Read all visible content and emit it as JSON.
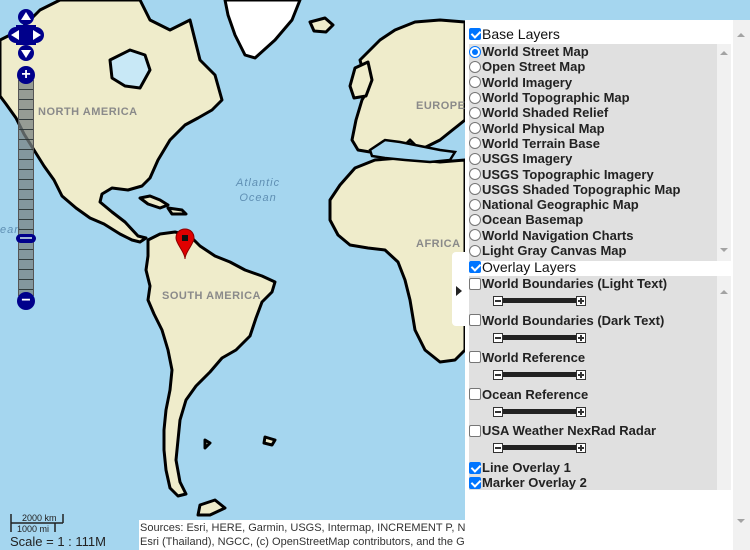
{
  "map": {
    "labels": {
      "north_america": "NORTH AMERICA",
      "south_america": "SOUTH AMERICA",
      "europe": "EUROPE",
      "africa": "AFRICA",
      "atlantic_line1": "Atlantic",
      "atlantic_line2": "Ocean",
      "pacific_fragment": "ean"
    },
    "colors": {
      "ocean": "#a5d6ef",
      "land": "#efeccb",
      "coastline": "#000000",
      "marker": "#e00000",
      "control": "#00008b"
    },
    "controls": {
      "pan_up": "pan-up",
      "pan_down": "pan-down",
      "pan_left": "pan-left",
      "pan_right": "pan-right",
      "zoom_in": "+",
      "zoom_out": "−",
      "zoom_level_fraction": 0.25
    },
    "scale": {
      "km": "2000 km",
      "mi": "1000 mi",
      "text": "Scale = 1 : 111M"
    },
    "attribution": {
      "line1": "Sources: Esri, HERE, Garmin, USGS, Intermap, INCREMENT P, NR",
      "line2": "Esri (Thailand), NGCC, (c) OpenStreetMap contributors, and the GIS"
    }
  },
  "layer_switcher": {
    "base_layers": {
      "label": "Base Layers",
      "checked": true,
      "items": [
        {
          "label": "World Street Map",
          "selected": true
        },
        {
          "label": "Open Street Map",
          "selected": false
        },
        {
          "label": "World Imagery",
          "selected": false
        },
        {
          "label": "World Topographic Map",
          "selected": false
        },
        {
          "label": "World Shaded Relief",
          "selected": false
        },
        {
          "label": "World Physical Map",
          "selected": false
        },
        {
          "label": "World Terrain Base",
          "selected": false
        },
        {
          "label": "USGS Imagery",
          "selected": false
        },
        {
          "label": "USGS Topographic Imagery",
          "selected": false
        },
        {
          "label": "USGS Shaded Topographic Map",
          "selected": false
        },
        {
          "label": "National Geographic Map",
          "selected": false
        },
        {
          "label": "Ocean Basemap",
          "selected": false
        },
        {
          "label": "World Navigation Charts",
          "selected": false
        },
        {
          "label": "Light Gray Canvas Map",
          "selected": false
        }
      ]
    },
    "overlay_layers": {
      "label": "Overlay Layers",
      "checked": true,
      "items": [
        {
          "label": "World Boundaries (Light Text)",
          "checked": false,
          "opacity": 1.0
        },
        {
          "label": "World Boundaries (Dark Text)",
          "checked": false,
          "opacity": 1.0
        },
        {
          "label": "World Reference",
          "checked": false,
          "opacity": 1.0
        },
        {
          "label": "Ocean Reference",
          "checked": false,
          "opacity": 1.0
        },
        {
          "label": "USA Weather NexRad Radar",
          "checked": false,
          "opacity": 1.0
        },
        {
          "label": "Line Overlay 1",
          "checked": true
        },
        {
          "label": "Marker Overlay 2",
          "checked": true
        }
      ]
    }
  }
}
